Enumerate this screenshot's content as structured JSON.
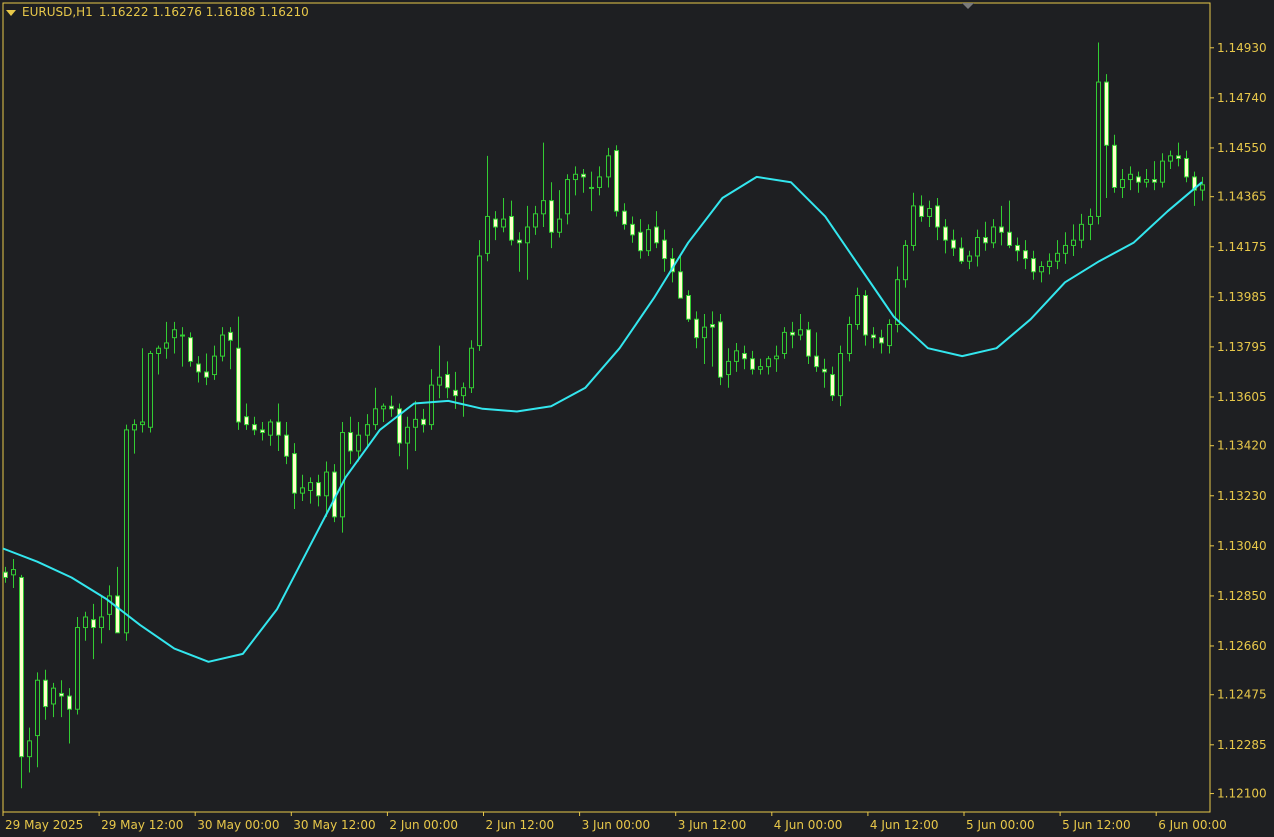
{
  "header": {
    "symbol": "EURUSD,H1",
    "ohlc": "1.16222 1.16276 1.16188 1.16210"
  },
  "colors": {
    "background": "#1e1f22",
    "frame": "#e8c84a",
    "axis_text": "#e8c84a",
    "bull_body": "#1e1f22",
    "bear_body": "#ffffcc",
    "wick": "#33cc33",
    "ma_line": "#33e6ee"
  },
  "chart_data": {
    "type": "candlestick",
    "timeframe": "H1",
    "ylim": [
      1.1203,
      1.151
    ],
    "y_ticks": [
      "1.14930",
      "1.14740",
      "1.14550",
      "1.14365",
      "1.14175",
      "1.13985",
      "1.13795",
      "1.13605",
      "1.13420",
      "1.13230",
      "1.13040",
      "1.12850",
      "1.12660",
      "1.12475",
      "1.12285",
      "1.12100"
    ],
    "x_ticks": [
      "29 May 2025",
      "29 May 12:00",
      "30 May 00:00",
      "30 May 12:00",
      "2 Jun 00:00",
      "2 Jun 12:00",
      "3 Jun 00:00",
      "3 Jun 12:00",
      "4 Jun 00:00",
      "4 Jun 12:00",
      "5 Jun 00:00",
      "5 Jun 12:00",
      "6 Jun 00:00"
    ],
    "candles": [
      [
        1.1294,
        1.1296,
        1.129,
        1.1292
      ],
      [
        1.1293,
        1.1299,
        1.1288,
        1.1295
      ],
      [
        1.1292,
        1.1293,
        1.1212,
        1.1224
      ],
      [
        1.1224,
        1.1235,
        1.1218,
        1.123
      ],
      [
        1.1232,
        1.1256,
        1.122,
        1.1253
      ],
      [
        1.1253,
        1.1257,
        1.1238,
        1.1243
      ],
      [
        1.1244,
        1.1252,
        1.1239,
        1.125
      ],
      [
        1.1248,
        1.1253,
        1.1239,
        1.1247
      ],
      [
        1.1247,
        1.125,
        1.1229,
        1.1242
      ],
      [
        1.1242,
        1.1277,
        1.124,
        1.1273
      ],
      [
        1.1273,
        1.1279,
        1.1268,
        1.1277
      ],
      [
        1.1276,
        1.1282,
        1.1261,
        1.1273
      ],
      [
        1.1273,
        1.1285,
        1.1267,
        1.1277
      ],
      [
        1.1278,
        1.1289,
        1.1272,
        1.1285
      ],
      [
        1.1285,
        1.1296,
        1.1275,
        1.1271
      ],
      [
        1.1271,
        1.135,
        1.1268,
        1.1348
      ],
      [
        1.1348,
        1.1352,
        1.1339,
        1.135
      ],
      [
        1.135,
        1.1379,
        1.1347,
        1.1351
      ],
      [
        1.1349,
        1.1378,
        1.1347,
        1.1377
      ],
      [
        1.1377,
        1.138,
        1.1369,
        1.1379
      ],
      [
        1.1379,
        1.1389,
        1.1375,
        1.1381
      ],
      [
        1.1383,
        1.1389,
        1.1377,
        1.1386
      ],
      [
        1.1384,
        1.1387,
        1.1372,
        1.1384
      ],
      [
        1.1383,
        1.1385,
        1.1372,
        1.1374
      ],
      [
        1.1373,
        1.1376,
        1.1366,
        1.137
      ],
      [
        1.137,
        1.1377,
        1.1365,
        1.1368
      ],
      [
        1.1369,
        1.138,
        1.1367,
        1.1376
      ],
      [
        1.1376,
        1.1387,
        1.1374,
        1.1384
      ],
      [
        1.1385,
        1.1387,
        1.1371,
        1.1382
      ],
      [
        1.1379,
        1.1391,
        1.1348,
        1.1351
      ],
      [
        1.1353,
        1.1358,
        1.1348,
        1.135
      ],
      [
        1.135,
        1.1353,
        1.1346,
        1.1348
      ],
      [
        1.1348,
        1.1351,
        1.1344,
        1.1347
      ],
      [
        1.1346,
        1.1352,
        1.1342,
        1.1351
      ],
      [
        1.1351,
        1.1358,
        1.134,
        1.1346
      ],
      [
        1.1346,
        1.1351,
        1.1335,
        1.1338
      ],
      [
        1.1339,
        1.1343,
        1.1318,
        1.1324
      ],
      [
        1.1324,
        1.1331,
        1.1321,
        1.1326
      ],
      [
        1.1325,
        1.133,
        1.132,
        1.1328
      ],
      [
        1.1328,
        1.1331,
        1.1319,
        1.1323
      ],
      [
        1.1323,
        1.1336,
        1.1315,
        1.1332
      ],
      [
        1.1332,
        1.1335,
        1.1313,
        1.1315
      ],
      [
        1.1315,
        1.1351,
        1.1309,
        1.1347
      ],
      [
        1.1347,
        1.1353,
        1.1335,
        1.134
      ],
      [
        1.134,
        1.1351,
        1.1336,
        1.1346
      ],
      [
        1.1346,
        1.1354,
        1.1342,
        1.135
      ],
      [
        1.135,
        1.1364,
        1.1348,
        1.1356
      ],
      [
        1.1356,
        1.1358,
        1.1351,
        1.1357
      ],
      [
        1.1357,
        1.1361,
        1.1353,
        1.1356
      ],
      [
        1.1356,
        1.1358,
        1.1338,
        1.1343
      ],
      [
        1.1343,
        1.1353,
        1.1333,
        1.1349
      ],
      [
        1.1349,
        1.1359,
        1.134,
        1.1352
      ],
      [
        1.1352,
        1.1356,
        1.1347,
        1.135
      ],
      [
        1.135,
        1.1371,
        1.1348,
        1.1365
      ],
      [
        1.1365,
        1.138,
        1.136,
        1.1368
      ],
      [
        1.1369,
        1.1374,
        1.136,
        1.1364
      ],
      [
        1.1363,
        1.137,
        1.1356,
        1.1361
      ],
      [
        1.1361,
        1.1366,
        1.1353,
        1.1364
      ],
      [
        1.1364,
        1.1382,
        1.1362,
        1.1379
      ],
      [
        1.138,
        1.142,
        1.1378,
        1.1414
      ],
      [
        1.1415,
        1.1452,
        1.1412,
        1.1429
      ],
      [
        1.1428,
        1.1431,
        1.142,
        1.1425
      ],
      [
        1.1425,
        1.1436,
        1.1423,
        1.1428
      ],
      [
        1.1429,
        1.1435,
        1.1418,
        1.142
      ],
      [
        1.142,
        1.1423,
        1.1408,
        1.1419
      ],
      [
        1.1419,
        1.1433,
        1.1405,
        1.1425
      ],
      [
        1.1425,
        1.1433,
        1.1422,
        1.143
      ],
      [
        1.143,
        1.1457,
        1.1425,
        1.1435
      ],
      [
        1.1435,
        1.1442,
        1.1417,
        1.1423
      ],
      [
        1.1423,
        1.1439,
        1.1421,
        1.1428
      ],
      [
        1.143,
        1.1445,
        1.1426,
        1.1443
      ],
      [
        1.1443,
        1.1448,
        1.1437,
        1.1445
      ],
      [
        1.1445,
        1.1447,
        1.1438,
        1.1444
      ],
      [
        1.144,
        1.1446,
        1.1431,
        1.144
      ],
      [
        1.144,
        1.1448,
        1.1437,
        1.1444
      ],
      [
        1.1444,
        1.1455,
        1.144,
        1.1452
      ],
      [
        1.1454,
        1.1456,
        1.1429,
        1.1431
      ],
      [
        1.1431,
        1.1434,
        1.1424,
        1.1426
      ],
      [
        1.1426,
        1.1429,
        1.1419,
        1.1422
      ],
      [
        1.1423,
        1.1428,
        1.1413,
        1.1416
      ],
      [
        1.1416,
        1.1426,
        1.1414,
        1.1424
      ],
      [
        1.1425,
        1.1431,
        1.1417,
        1.1419
      ],
      [
        1.142,
        1.1424,
        1.1408,
        1.1413
      ],
      [
        1.1413,
        1.1417,
        1.1404,
        1.1408
      ],
      [
        1.1408,
        1.1414,
        1.14,
        1.1398
      ],
      [
        1.1399,
        1.1401,
        1.1389,
        1.139
      ],
      [
        1.139,
        1.1393,
        1.1379,
        1.1383
      ],
      [
        1.1383,
        1.1392,
        1.1373,
        1.1387
      ],
      [
        1.1388,
        1.1393,
        1.1372,
        1.1387
      ],
      [
        1.1389,
        1.1392,
        1.1365,
        1.1368
      ],
      [
        1.1369,
        1.1379,
        1.1364,
        1.1374
      ],
      [
        1.1374,
        1.1381,
        1.137,
        1.1378
      ],
      [
        1.1377,
        1.138,
        1.1371,
        1.1375
      ],
      [
        1.1375,
        1.1378,
        1.1369,
        1.1371
      ],
      [
        1.1371,
        1.1375,
        1.1369,
        1.1372
      ],
      [
        1.1372,
        1.1376,
        1.1369,
        1.1375
      ],
      [
        1.1375,
        1.138,
        1.137,
        1.1376
      ],
      [
        1.1377,
        1.1387,
        1.1375,
        1.1385
      ],
      [
        1.1385,
        1.1389,
        1.1379,
        1.1384
      ],
      [
        1.1384,
        1.1392,
        1.1382,
        1.1386
      ],
      [
        1.1386,
        1.1389,
        1.1373,
        1.1376
      ],
      [
        1.1376,
        1.1385,
        1.137,
        1.1372
      ],
      [
        1.1371,
        1.1375,
        1.1364,
        1.137
      ],
      [
        1.1369,
        1.1372,
        1.1359,
        1.1361
      ],
      [
        1.1361,
        1.138,
        1.1357,
        1.1377
      ],
      [
        1.1377,
        1.1391,
        1.1374,
        1.1388
      ],
      [
        1.1388,
        1.1402,
        1.1386,
        1.1399
      ],
      [
        1.1399,
        1.1401,
        1.138,
        1.1384
      ],
      [
        1.1384,
        1.1387,
        1.1379,
        1.1383
      ],
      [
        1.1383,
        1.1386,
        1.1377,
        1.1381
      ],
      [
        1.138,
        1.139,
        1.1377,
        1.1388
      ],
      [
        1.1388,
        1.141,
        1.1385,
        1.1405
      ],
      [
        1.1405,
        1.142,
        1.1402,
        1.1418
      ],
      [
        1.1418,
        1.1438,
        1.1416,
        1.1433
      ],
      [
        1.1433,
        1.1437,
        1.1427,
        1.1429
      ],
      [
        1.1429,
        1.1435,
        1.1425,
        1.1432
      ],
      [
        1.1433,
        1.1436,
        1.142,
        1.1425
      ],
      [
        1.1425,
        1.1428,
        1.1415,
        1.142
      ],
      [
        1.142,
        1.1424,
        1.1414,
        1.1417
      ],
      [
        1.1417,
        1.1421,
        1.1411,
        1.1412
      ],
      [
        1.1412,
        1.1416,
        1.1409,
        1.1414
      ],
      [
        1.1414,
        1.1424,
        1.141,
        1.1421
      ],
      [
        1.1421,
        1.1427,
        1.1416,
        1.1419
      ],
      [
        1.1419,
        1.1428,
        1.1417,
        1.1425
      ],
      [
        1.1425,
        1.1433,
        1.1418,
        1.1423
      ],
      [
        1.1423,
        1.1435,
        1.1417,
        1.1418
      ],
      [
        1.1418,
        1.1421,
        1.1412,
        1.1416
      ],
      [
        1.1416,
        1.142,
        1.1409,
        1.1413
      ],
      [
        1.1413,
        1.1416,
        1.1405,
        1.1408
      ],
      [
        1.1408,
        1.1412,
        1.1404,
        1.141
      ],
      [
        1.141,
        1.1415,
        1.1407,
        1.1412
      ],
      [
        1.1412,
        1.142,
        1.1409,
        1.1415
      ],
      [
        1.1415,
        1.1423,
        1.1411,
        1.1418
      ],
      [
        1.1418,
        1.1426,
        1.1414,
        1.142
      ],
      [
        1.142,
        1.143,
        1.1417,
        1.1426
      ],
      [
        1.1426,
        1.1432,
        1.142,
        1.1429
      ],
      [
        1.1429,
        1.1495,
        1.1426,
        1.148
      ],
      [
        1.148,
        1.1483,
        1.1436,
        1.1456
      ],
      [
        1.1456,
        1.146,
        1.1438,
        1.144
      ],
      [
        1.144,
        1.1447,
        1.1436,
        1.1443
      ],
      [
        1.1443,
        1.1448,
        1.1439,
        1.1445
      ],
      [
        1.1444,
        1.1446,
        1.1438,
        1.1442
      ],
      [
        1.1442,
        1.1447,
        1.144,
        1.1443
      ],
      [
        1.1443,
        1.145,
        1.1439,
        1.1442
      ],
      [
        1.1442,
        1.1453,
        1.144,
        1.145
      ],
      [
        1.145,
        1.1454,
        1.1447,
        1.1452
      ],
      [
        1.1452,
        1.1457,
        1.1448,
        1.1451
      ],
      [
        1.1451,
        1.1454,
        1.1442,
        1.1444
      ],
      [
        1.1444,
        1.1446,
        1.1433,
        1.1439
      ],
      [
        1.1439,
        1.1444,
        1.1435,
        1.1441
      ]
    ],
    "ma": [
      1.1303,
      1.1298,
      1.1292,
      1.1284,
      1.1274,
      1.1265,
      1.126,
      1.1263,
      1.128,
      1.1305,
      1.133,
      1.1348,
      1.1358,
      1.1359,
      1.1356,
      1.1355,
      1.1357,
      1.1364,
      1.1379,
      1.1398,
      1.1419,
      1.1436,
      1.1444,
      1.1442,
      1.1429,
      1.141,
      1.1391,
      1.1379,
      1.1376,
      1.1379,
      1.139,
      1.1404,
      1.1412,
      1.1419,
      1.1431,
      1.1442
    ]
  }
}
